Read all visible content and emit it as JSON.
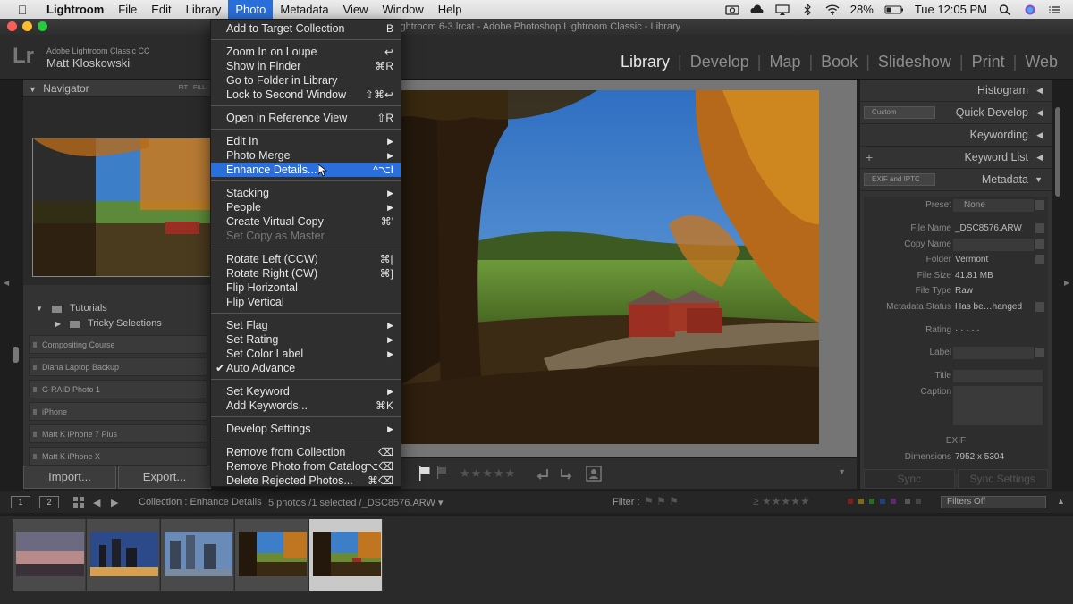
{
  "menubar": {
    "app": "Lightroom",
    "items": [
      "File",
      "Edit",
      "Library",
      "Photo",
      "Metadata",
      "View",
      "Window",
      "Help"
    ],
    "battery": "28%",
    "clock": "Tue 12:05 PM"
  },
  "window_title": "Lightroom 6-3.lrcat - Adobe Photoshop Lightroom Classic - Library",
  "identity": {
    "logo": "Lr",
    "product": "Adobe Lightroom Classic CC",
    "user": "Matt Kloskowski"
  },
  "modules": [
    "Library",
    "Develop",
    "Map",
    "Book",
    "Slideshow",
    "Print",
    "Web"
  ],
  "left_panel": {
    "navigator_title": "Navigator",
    "fit": "FIT",
    "fill": "FILL",
    "folders": [
      "Tutorials",
      "Tricky Selections"
    ],
    "volumes": [
      "Compositing Course",
      "Diana Laptop Backup",
      "G-RAID Photo 1",
      "iPhone",
      "Matt K iPhone 7 Plus",
      "Matt K iPhone X"
    ],
    "import_label": "Import...",
    "export_label": "Export..."
  },
  "photo_menu": {
    "items": [
      {
        "label": "Add to Target Collection",
        "shortcut": "B"
      },
      {
        "label": "Zoom In on Loupe",
        "shortcut": "↩"
      },
      {
        "label": "Show in Finder",
        "shortcut": "⌘R"
      },
      {
        "label": "Go to Folder in Library",
        "shortcut": ""
      },
      {
        "label": "Lock to Second Window",
        "shortcut": "⇧⌘↩"
      },
      {
        "label": "Open in Reference View",
        "shortcut": "⇧R"
      },
      {
        "label": "Edit In",
        "shortcut": "▶"
      },
      {
        "label": "Photo Merge",
        "shortcut": "▶"
      },
      {
        "label": "Enhance Details...",
        "shortcut": "^⌥I"
      },
      {
        "label": "Stacking",
        "shortcut": "▶"
      },
      {
        "label": "People",
        "shortcut": "▶"
      },
      {
        "label": "Create Virtual Copy",
        "shortcut": "⌘'"
      },
      {
        "label": "Set Copy as Master",
        "shortcut": ""
      },
      {
        "label": "Rotate Left (CCW)",
        "shortcut": "⌘["
      },
      {
        "label": "Rotate Right (CW)",
        "shortcut": "⌘]"
      },
      {
        "label": "Flip Horizontal",
        "shortcut": ""
      },
      {
        "label": "Flip Vertical",
        "shortcut": ""
      },
      {
        "label": "Set Flag",
        "shortcut": "▶"
      },
      {
        "label": "Set Rating",
        "shortcut": "▶"
      },
      {
        "label": "Set Color Label",
        "shortcut": "▶"
      },
      {
        "label": "Auto Advance",
        "shortcut": ""
      },
      {
        "label": "Set Keyword",
        "shortcut": "▶"
      },
      {
        "label": "Add Keywords...",
        "shortcut": "⌘K"
      },
      {
        "label": "Develop Settings",
        "shortcut": "▶"
      },
      {
        "label": "Remove from Collection",
        "shortcut": "⌫"
      },
      {
        "label": "Remove Photo from Catalog",
        "shortcut": "⌥⌫"
      },
      {
        "label": "Delete Rejected Photos...",
        "shortcut": "⌘⌫"
      }
    ],
    "highlighted": "Enhance Details...",
    "checked": "Auto Advance",
    "disabled": "Set Copy as Master"
  },
  "right_panel": {
    "histogram": "Histogram",
    "quick_develop": "Quick Develop",
    "quick_develop_preset": "Custom",
    "keywording": "Keywording",
    "keyword_list": "Keyword List",
    "metadata": "Metadata",
    "metadata_preset": "EXIF and IPTC",
    "preset_label": "Preset",
    "preset_value": "None",
    "fields": [
      {
        "key": "File Name",
        "value": "_DSC8576.ARW"
      },
      {
        "key": "Copy Name",
        "value": ""
      },
      {
        "key": "Folder",
        "value": "Vermont"
      },
      {
        "key": "File Size",
        "value": "41.81 MB"
      },
      {
        "key": "File Type",
        "value": "Raw"
      },
      {
        "key": "Metadata Status",
        "value": "Has be…hanged"
      },
      {
        "key": "Rating",
        "value": "· · · · ·"
      },
      {
        "key": "Label",
        "value": ""
      },
      {
        "key": "Title",
        "value": ""
      },
      {
        "key": "Caption",
        "value": ""
      }
    ],
    "exif_label": "EXIF",
    "dimensions_key": "Dimensions",
    "dimensions_value": "7952 x 5304",
    "sync_label": "Sync",
    "sync_settings_label": "Sync Settings"
  },
  "filmstrip_bar": {
    "page1": "1",
    "page2": "2",
    "collection": "Collection : Enhance Details",
    "count": "5 photos /1 selected /_DSC8576.ARW ▾",
    "filter_label": "Filter :",
    "filter_value": "Filters Off"
  },
  "colors": {
    "menu_highlight": "#2a6fdb",
    "panel_bg": "#333333",
    "background_gray": "#757575"
  }
}
